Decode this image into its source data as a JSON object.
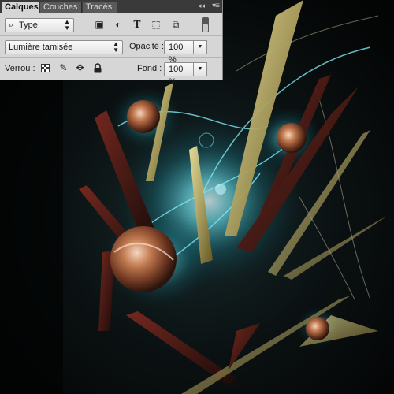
{
  "panel": {
    "tabs": [
      {
        "label": "Calques",
        "active": true
      },
      {
        "label": "Couches",
        "active": false
      },
      {
        "label": "Tracés",
        "active": false
      }
    ],
    "collapse_glyph": "◂◂",
    "menu_glyph": "▾≡",
    "filter": {
      "selected": "Type",
      "icon": "search-icon",
      "kind_icons": [
        "pixel-layer-icon",
        "adjustment-layer-icon",
        "type-layer-icon",
        "shape-layer-icon",
        "smart-object-icon"
      ],
      "kind_glyphs": [
        "▣",
        "◐",
        "T",
        "⬚",
        "⧉"
      ]
    },
    "blend_mode": "Lumière tamisée",
    "opacity": {
      "label": "Opacité :",
      "value": "100 %"
    },
    "lock": {
      "label": "Verrou :",
      "icons": [
        "lock-transparent-pixels-icon",
        "lock-image-pixels-icon",
        "lock-position-icon",
        "lock-all-icon"
      ],
      "glyphs": [
        "",
        "✎",
        "✥",
        "🔒"
      ]
    },
    "fill": {
      "label": "Fond :",
      "value": "100 %"
    }
  },
  "colors": {
    "panel_bg": "#d6d6d6",
    "tabbar_bg": "#3a3a3a",
    "artwork_glow": "#4fd2e6",
    "artwork_orb": "#b7683f",
    "artwork_gold": "#c8b45a"
  }
}
